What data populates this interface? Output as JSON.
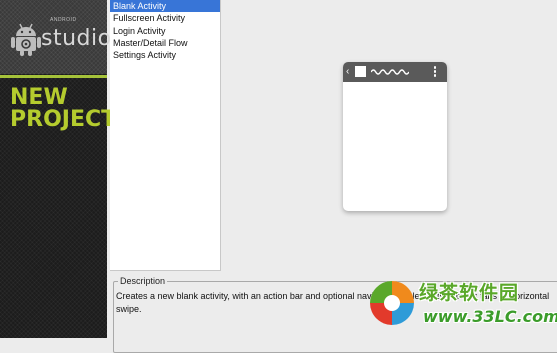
{
  "sidebar": {
    "logo_small": "ANDROID",
    "logo_text": "studio",
    "heading_line1": "NEW",
    "heading_line2": "PROJECT",
    "accent_color": "#b5cc2e"
  },
  "activities": {
    "items": [
      {
        "label": "Blank Activity",
        "selected": true
      },
      {
        "label": "Fullscreen Activity",
        "selected": false
      },
      {
        "label": "Login Activity",
        "selected": false
      },
      {
        "label": "Master/Detail Flow",
        "selected": false
      },
      {
        "label": "Settings Activity",
        "selected": false
      }
    ],
    "selected_color": "#3875d7"
  },
  "description": {
    "legend": "Description",
    "text": "Creates a new blank activity, with an action bar and optional navigational elements such as tabs or horizontal swipe."
  },
  "watermark": {
    "brand_cn": "绿茶软件园",
    "url": "www.33LC.com"
  }
}
